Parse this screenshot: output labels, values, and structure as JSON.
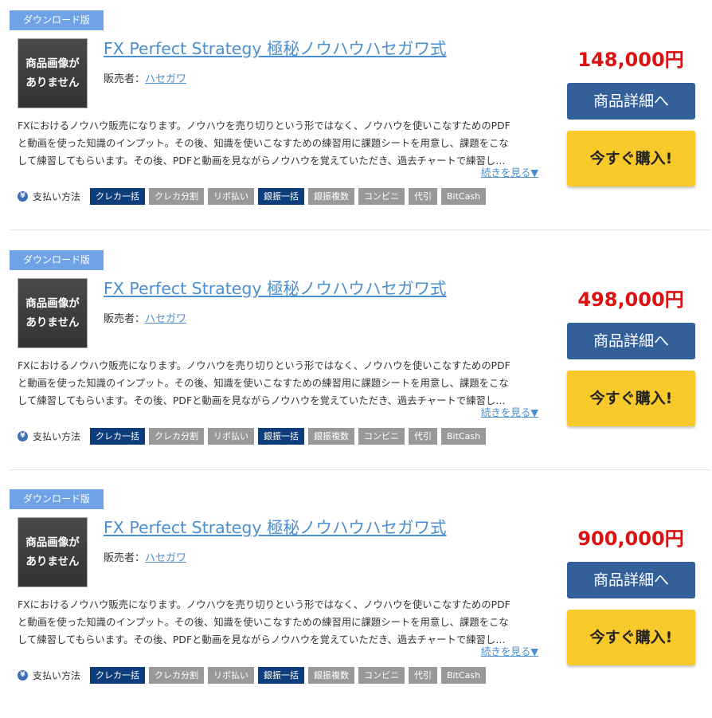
{
  "products": [
    {
      "badge": "ダウンロード版",
      "thumb_line1": "商品画像が",
      "thumb_line2": "ありません",
      "title": "FX Perfect Strategy 極秘ノウハウハセガワ式",
      "seller_label": "販売者：",
      "seller_name": "ハセガワ",
      "desc_lines": [
        "FXにおけるノウハウ販売になります。ノウハウを売り切りという形ではなく、ノウハウを使いこなすためのPDF",
        "と動画を使った知識のインプット。その後、知識を使いこなすための練習用に課題シートを用意し、課題をこな",
        "して練習してもらいます。その後、PDFと動画を見ながらノウハウを覚えていただき、過去チャートで練習し…"
      ],
      "more_label": "続きを見る▼",
      "price": "148,000円",
      "detail_label": "商品詳細へ",
      "buy_label": "今すぐ購入!"
    },
    {
      "badge": "ダウンロード版",
      "thumb_line1": "商品画像が",
      "thumb_line2": "ありません",
      "title": "FX Perfect Strategy 極秘ノウハウハセガワ式",
      "seller_label": "販売者：",
      "seller_name": "ハセガワ",
      "desc_lines": [
        "FXにおけるノウハウ販売になります。ノウハウを売り切りという形ではなく、ノウハウを使いこなすためのPDF",
        "と動画を使った知識のインプット。その後、知識を使いこなすための練習用に課題シートを用意し、課題をこな",
        "して練習してもらいます。その後、PDFと動画を見ながらノウハウを覚えていただき、過去チャートで練習し…"
      ],
      "more_label": "続きを見る▼",
      "price": "498,000円",
      "detail_label": "商品詳細へ",
      "buy_label": "今すぐ購入!"
    },
    {
      "badge": "ダウンロード版",
      "thumb_line1": "商品画像が",
      "thumb_line2": "ありません",
      "title": "FX Perfect Strategy 極秘ノウハウハセガワ式",
      "seller_label": "販売者：",
      "seller_name": "ハセガワ",
      "desc_lines": [
        "FXにおけるノウハウ販売になります。ノウハウを売り切りという形ではなく、ノウハウを使いこなすためのPDF",
        "と動画を使った知識のインプット。その後、知識を使いこなすための練習用に課題シートを用意し、課題をこな",
        "して練習してもらいます。その後、PDFと動画を見ながらノウハウを覚えていただき、過去チャートで練習し…"
      ],
      "more_label": "続きを見る▼",
      "price": "900,000円",
      "detail_label": "商品詳細へ",
      "buy_label": "今すぐ購入!"
    }
  ],
  "payment": {
    "icon": "yen-icon",
    "icon_glyph": "¥",
    "label": "支払い方法",
    "methods": [
      {
        "label": "クレカ一括",
        "active": true
      },
      {
        "label": "クレカ分割",
        "active": false
      },
      {
        "label": "リボ払い",
        "active": false
      },
      {
        "label": "銀振一括",
        "active": true
      },
      {
        "label": "銀振複数",
        "active": false
      },
      {
        "label": "コンビニ",
        "active": false
      },
      {
        "label": "代引",
        "active": false
      },
      {
        "label": "BitCash",
        "active": false
      }
    ]
  },
  "colors": {
    "badge": "#6fa3e6",
    "link": "#4a8fd0",
    "price": "#dd1111",
    "detail_button": "#34609a",
    "buy_button": "#f8c92b",
    "payment_active": "#0d3d7a",
    "payment_inactive": "#999999"
  }
}
